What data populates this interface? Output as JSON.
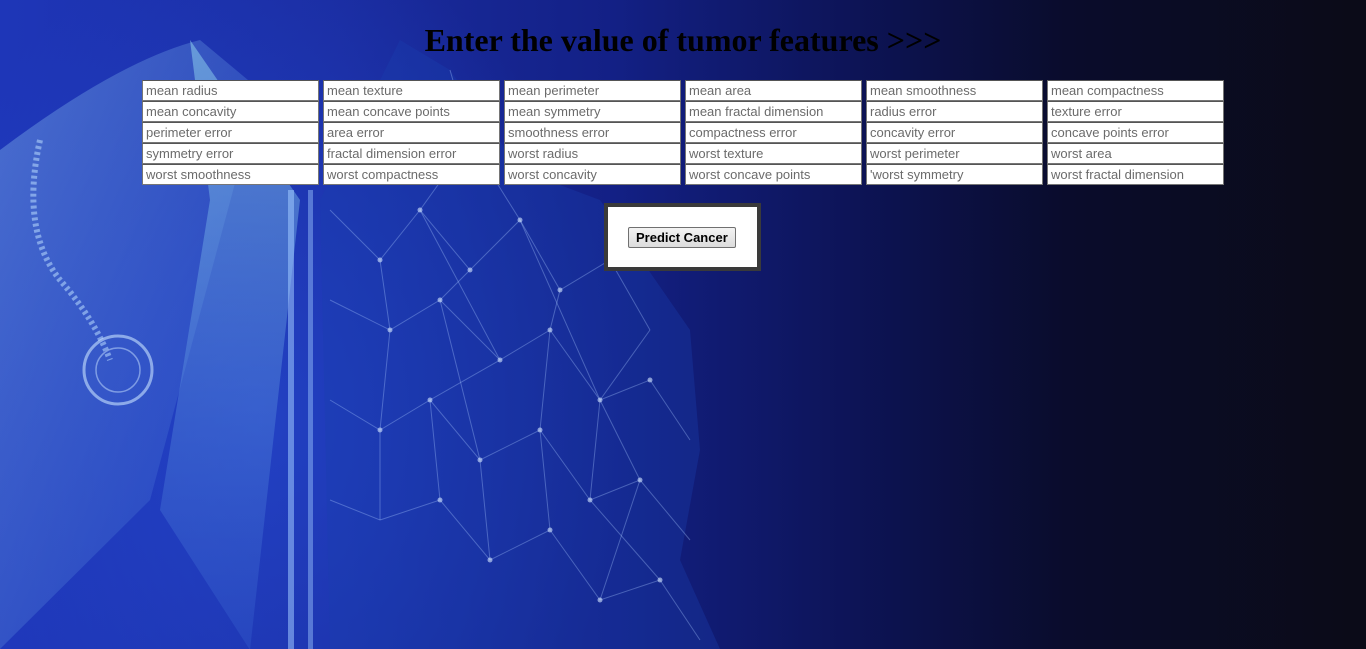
{
  "header": {
    "title": "Enter the value of tumor features >>>"
  },
  "form": {
    "fields": [
      {
        "placeholder": "mean radius"
      },
      {
        "placeholder": "mean texture"
      },
      {
        "placeholder": "mean perimeter"
      },
      {
        "placeholder": "mean area"
      },
      {
        "placeholder": "mean smoothness"
      },
      {
        "placeholder": "mean compactness"
      },
      {
        "placeholder": "mean concavity"
      },
      {
        "placeholder": "mean concave points"
      },
      {
        "placeholder": "mean symmetry"
      },
      {
        "placeholder": "mean fractal dimension"
      },
      {
        "placeholder": "radius error"
      },
      {
        "placeholder": "texture error"
      },
      {
        "placeholder": "perimeter error"
      },
      {
        "placeholder": "area error"
      },
      {
        "placeholder": "smoothness error"
      },
      {
        "placeholder": "compactness error"
      },
      {
        "placeholder": "concavity error"
      },
      {
        "placeholder": "concave points error"
      },
      {
        "placeholder": "symmetry error"
      },
      {
        "placeholder": "fractal dimension error"
      },
      {
        "placeholder": "worst radius"
      },
      {
        "placeholder": "worst texture"
      },
      {
        "placeholder": "worst perimeter"
      },
      {
        "placeholder": "worst area"
      },
      {
        "placeholder": "worst smoothness"
      },
      {
        "placeholder": "worst compactness"
      },
      {
        "placeholder": "worst concavity"
      },
      {
        "placeholder": "worst concave points"
      },
      {
        "placeholder": "'worst symmetry"
      },
      {
        "placeholder": "worst fractal dimension"
      }
    ],
    "submit_label": "Predict Cancer"
  },
  "background": {
    "description_icon": "doctor-coat-illustration",
    "colors": {
      "left": "#1e36b8",
      "middle": "#132085",
      "right": "#0b0b17"
    }
  }
}
